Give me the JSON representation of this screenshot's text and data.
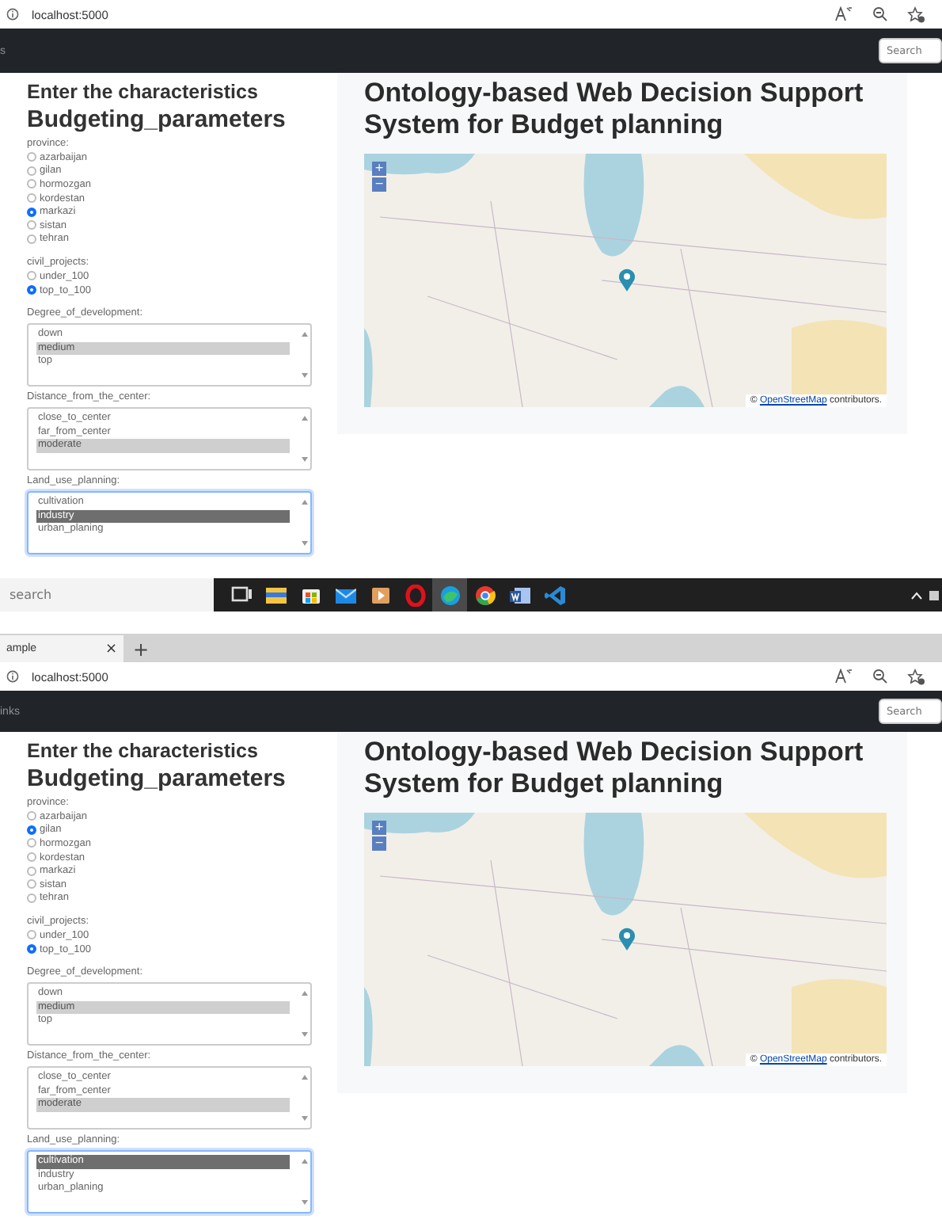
{
  "screenshots": [
    {
      "address_bar": {
        "url": "localhost:5000"
      },
      "navbar": {
        "link": "s",
        "search_placeholder": "Search"
      },
      "form": {
        "heading": "Enter the characteristics",
        "title": "Budgeting_parameters",
        "groups": [
          {
            "kind": "radio",
            "label": "province:",
            "options": [
              {
                "label": "azarbaijan",
                "selected": false
              },
              {
                "label": "gilan",
                "selected": false
              },
              {
                "label": "hormozgan",
                "selected": false
              },
              {
                "label": "kordestan",
                "selected": false
              },
              {
                "label": "markazi",
                "selected": true
              },
              {
                "label": "sistan",
                "selected": false
              },
              {
                "label": "tehran",
                "selected": false
              }
            ]
          },
          {
            "kind": "radio",
            "label": "civil_projects:",
            "options": [
              {
                "label": "under_100",
                "selected": false
              },
              {
                "label": "top_to_100",
                "selected": true
              }
            ]
          },
          {
            "kind": "listbox",
            "label": "Degree_of_development:",
            "focused": false,
            "options": [
              {
                "label": "down",
                "selected": false
              },
              {
                "label": "medium",
                "selected": true
              },
              {
                "label": "top",
                "selected": false
              }
            ]
          },
          {
            "kind": "listbox",
            "label": "Distance_from_the_center:",
            "focused": false,
            "options": [
              {
                "label": "close_to_center",
                "selected": false
              },
              {
                "label": "far_from_center",
                "selected": false
              },
              {
                "label": "moderate",
                "selected": true
              }
            ]
          },
          {
            "kind": "listbox",
            "label": "Land_use_planning:",
            "focused": true,
            "options": [
              {
                "label": "cultivation",
                "selected": false
              },
              {
                "label": "industry",
                "selected": true
              },
              {
                "label": "urban_planing",
                "selected": false
              }
            ]
          }
        ]
      },
      "panel": {
        "title": "Ontology-based Web Decision Support System for Budget planning",
        "map": {
          "zoom_in": "+",
          "zoom_out": "−",
          "attribution_prefix": "©",
          "attribution_link": "OpenStreetMap",
          "attribution_suffix": "contributors."
        }
      },
      "taskbar": {
        "search_placeholder": "search",
        "apps": [
          {
            "kind": "taskview",
            "selected": false
          },
          {
            "kind": "explorer",
            "selected": false
          },
          {
            "kind": "store",
            "selected": false
          },
          {
            "kind": "mail",
            "selected": false
          },
          {
            "kind": "media",
            "selected": false
          },
          {
            "kind": "opera",
            "selected": false
          },
          {
            "kind": "edge",
            "selected": true
          },
          {
            "kind": "chrome",
            "selected": false
          },
          {
            "kind": "word",
            "selected": false
          },
          {
            "kind": "code",
            "selected": false
          }
        ]
      }
    },
    {
      "tab_bar": {
        "tab_title": "ample",
        "close": "×",
        "new_tab": "+"
      },
      "address_bar": {
        "url": "localhost:5000"
      },
      "navbar": {
        "link": "inks",
        "search_placeholder": "Search"
      },
      "form": {
        "heading": "Enter the characteristics",
        "title": "Budgeting_parameters",
        "groups": [
          {
            "kind": "radio",
            "label": "province:",
            "options": [
              {
                "label": "azarbaijan",
                "selected": false
              },
              {
                "label": "gilan",
                "selected": true
              },
              {
                "label": "hormozgan",
                "selected": false
              },
              {
                "label": "kordestan",
                "selected": false
              },
              {
                "label": "markazi",
                "selected": false
              },
              {
                "label": "sistan",
                "selected": false
              },
              {
                "label": "tehran",
                "selected": false
              }
            ]
          },
          {
            "kind": "radio",
            "label": "civil_projects:",
            "options": [
              {
                "label": "under_100",
                "selected": false
              },
              {
                "label": "top_to_100",
                "selected": true
              }
            ]
          },
          {
            "kind": "listbox",
            "label": "Degree_of_development:",
            "focused": false,
            "options": [
              {
                "label": "down",
                "selected": false
              },
              {
                "label": "medium",
                "selected": true
              },
              {
                "label": "top",
                "selected": false
              }
            ]
          },
          {
            "kind": "listbox",
            "label": "Distance_from_the_center:",
            "focused": false,
            "options": [
              {
                "label": "close_to_center",
                "selected": false
              },
              {
                "label": "far_from_center",
                "selected": false
              },
              {
                "label": "moderate",
                "selected": true
              }
            ]
          },
          {
            "kind": "listbox",
            "label": "Land_use_planning:",
            "focused": true,
            "options": [
              {
                "label": "cultivation",
                "selected": true
              },
              {
                "label": "industry",
                "selected": false
              },
              {
                "label": "urban_planing",
                "selected": false
              }
            ]
          }
        ]
      },
      "panel": {
        "title": "Ontology-based Web Decision Support System for Budget planning",
        "map": {
          "zoom_in": "+",
          "zoom_out": "−",
          "attribution_prefix": "©",
          "attribution_link": "OpenStreetMap",
          "attribution_suffix": "contributors."
        }
      }
    }
  ]
}
